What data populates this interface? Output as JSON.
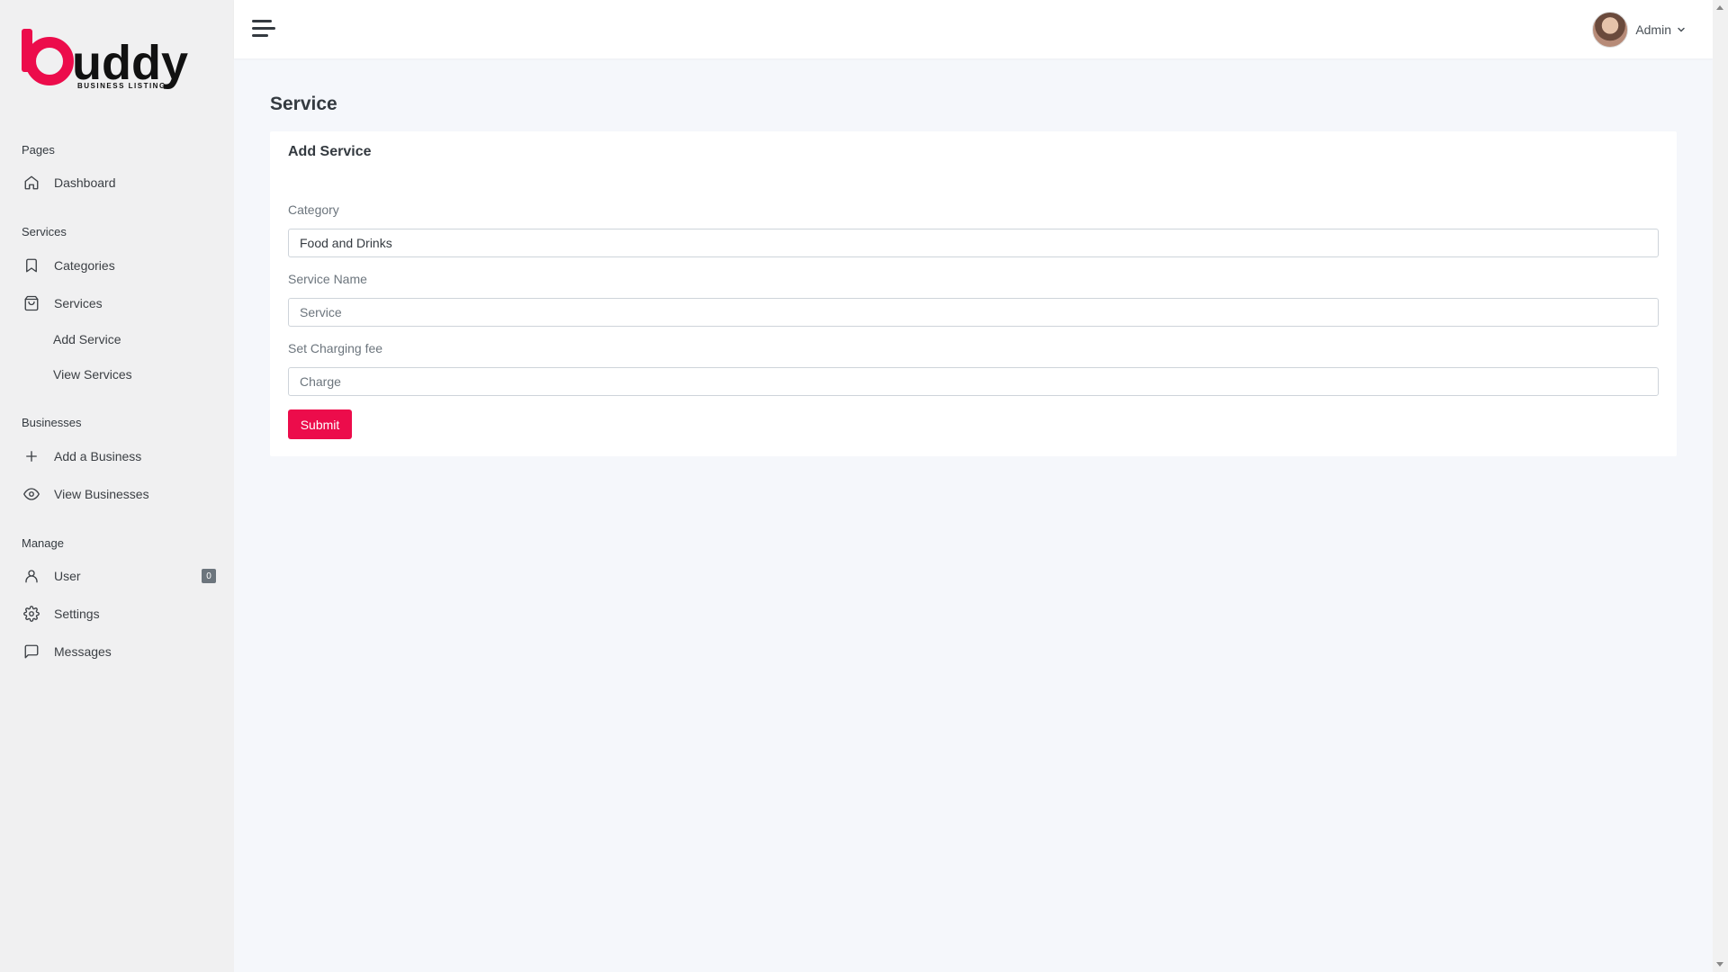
{
  "brand": {
    "name": "buddy",
    "tagline": "BUSINESS LISTING",
    "accent": "#ec0c4b"
  },
  "sidebar": {
    "sections": [
      {
        "header": "Pages"
      },
      {
        "header": "Services"
      },
      {
        "header": "Businesses"
      },
      {
        "header": "Manage"
      }
    ],
    "items": {
      "dashboard": {
        "label": "Dashboard",
        "icon": "home-icon"
      },
      "categories": {
        "label": "Categories",
        "icon": "bookmark-icon"
      },
      "services": {
        "label": "Services",
        "icon": "shopping-bag-icon"
      },
      "add_service": {
        "label": "Add Service"
      },
      "view_services": {
        "label": "View Services"
      },
      "add_business": {
        "label": "Add a Business",
        "icon": "plus-icon"
      },
      "view_businesses": {
        "label": "View Businesses",
        "icon": "eye-icon"
      },
      "user": {
        "label": "User",
        "icon": "user-icon",
        "badge": "0"
      },
      "settings": {
        "label": "Settings",
        "icon": "gear-icon"
      },
      "messages": {
        "label": "Messages",
        "icon": "message-square-icon"
      }
    }
  },
  "topbar": {
    "menu_icon": "hamburger-icon",
    "user_name": "Admin"
  },
  "main": {
    "page_title": "Service",
    "card": {
      "title": "Add Service",
      "fields": {
        "category": {
          "label": "Category",
          "value": "Food and Drinks"
        },
        "service_name": {
          "label": "Service Name",
          "placeholder": "Service"
        },
        "charge": {
          "label": "Set Charging fee",
          "placeholder": "Charge"
        }
      },
      "submit_label": "Submit"
    }
  }
}
